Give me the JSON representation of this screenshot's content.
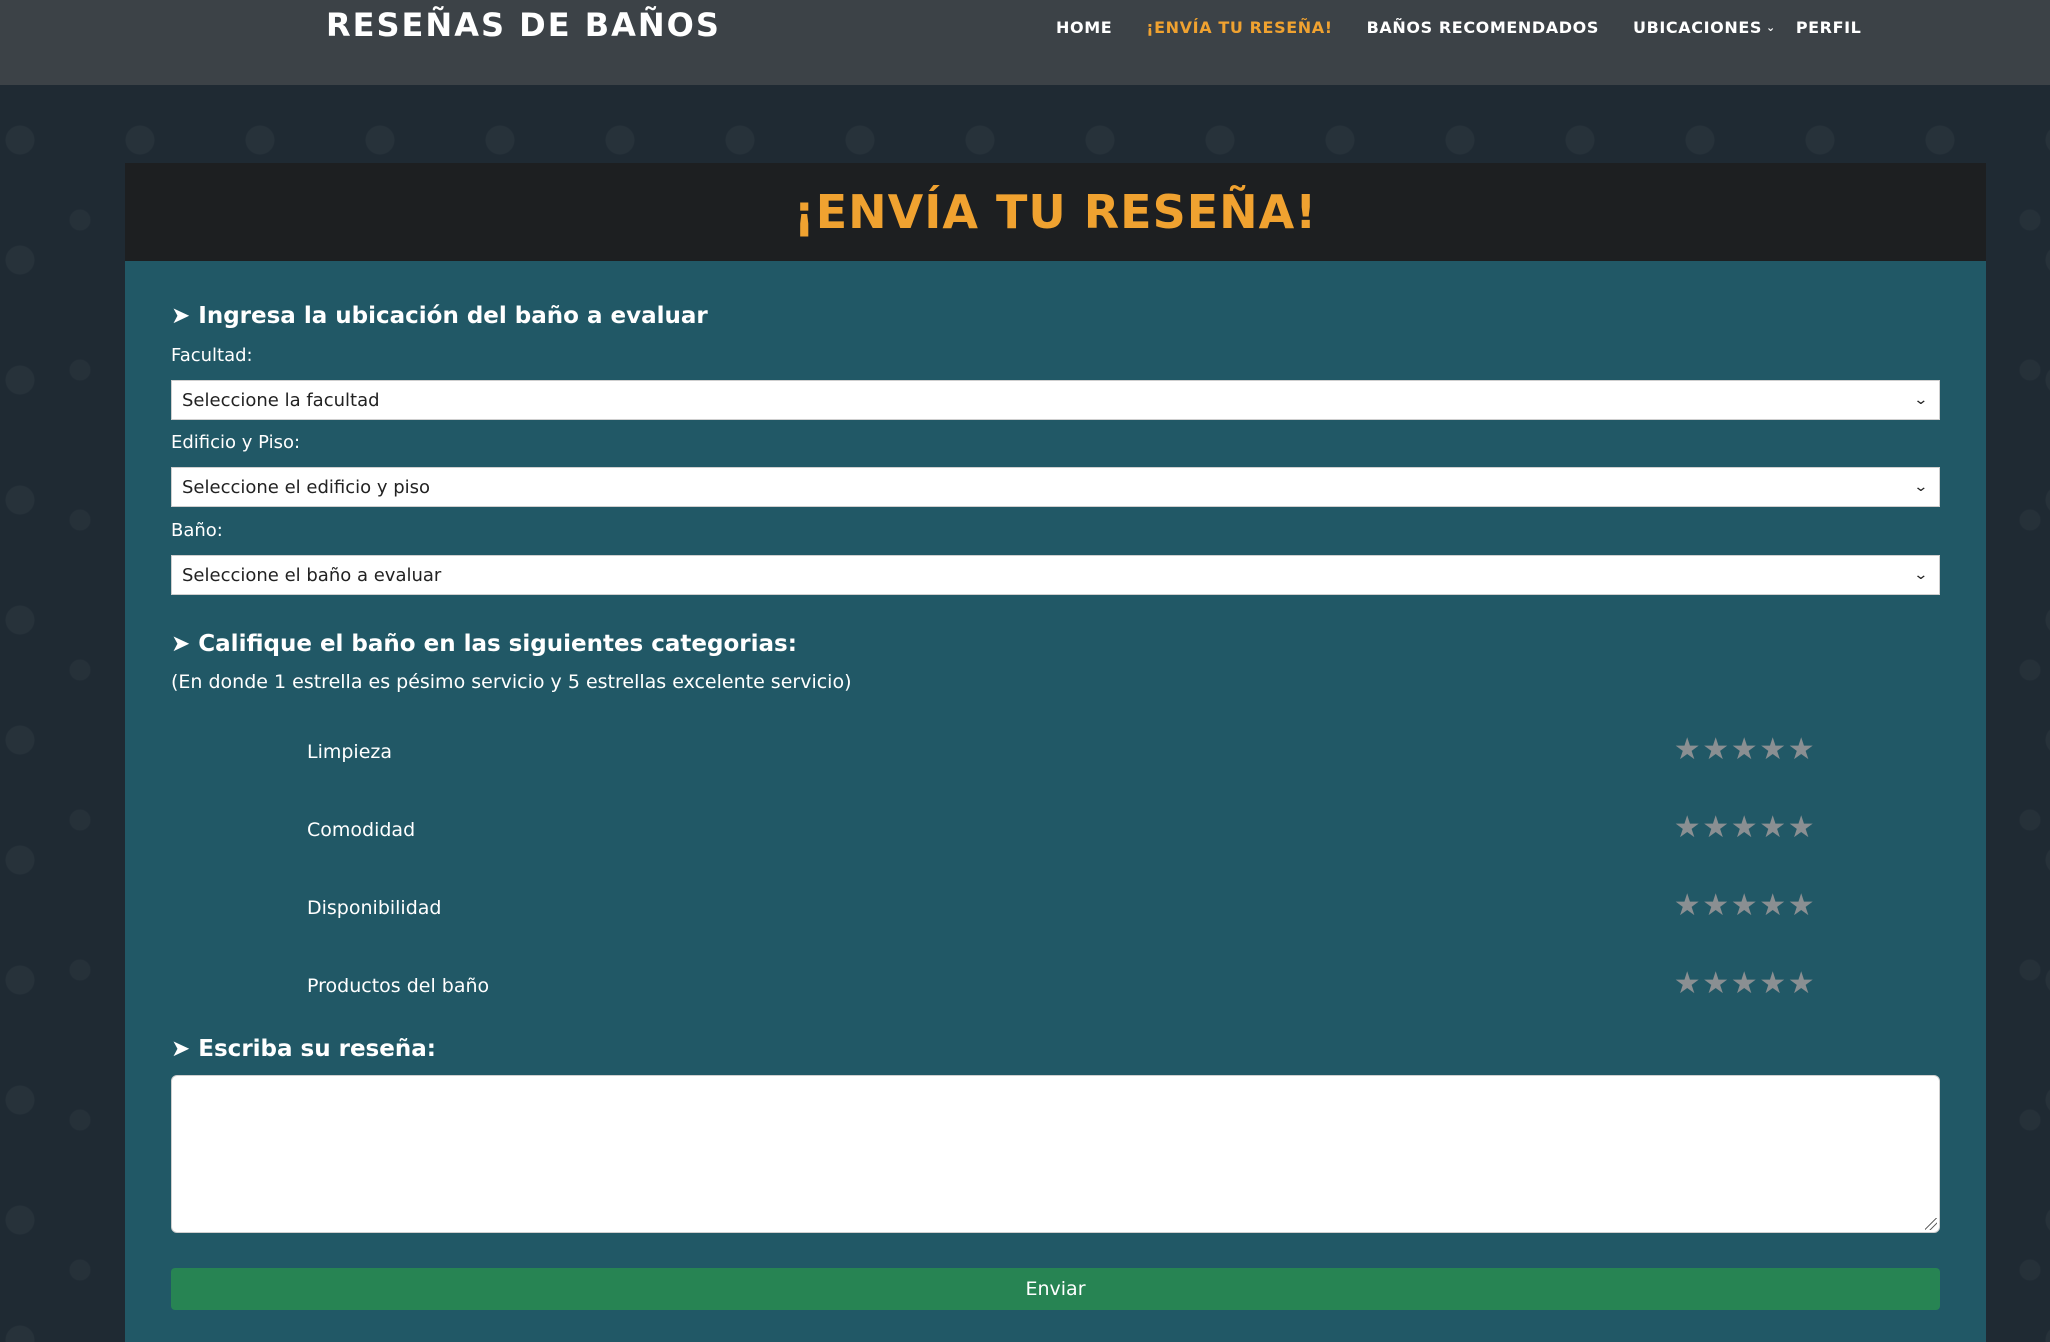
{
  "nav": {
    "brand": "RESEÑAS DE BAÑOS",
    "links": [
      {
        "label": "HOME"
      },
      {
        "label": "¡ENVÍA TU RESEÑA!"
      },
      {
        "label": "BAÑOS RECOMENDADOS"
      },
      {
        "label": "UBICACIONES"
      },
      {
        "label": "PERFIL"
      }
    ],
    "active_color": "#f0a230"
  },
  "card": {
    "title": "¡ENVÍA TU RESEÑA!",
    "location_section": "➤ Ingresa la ubicación del baño a evaluar",
    "fields": [
      {
        "label": "Facultad:",
        "selected": "Seleccione la facultad"
      },
      {
        "label": "Edificio y Piso:",
        "selected": "Seleccione el edificio y piso"
      },
      {
        "label": "Baño:",
        "selected": "Seleccione el baño a evaluar"
      }
    ],
    "rating_section": "➤ Califique el baño en las siguientes categorias:",
    "rating_hint": "(En donde 1 estrella es pésimo servicio y 5 estrellas excelente servicio)",
    "ratings": [
      {
        "label": "Limpieza",
        "stars": 5,
        "value": 0
      },
      {
        "label": "Comodidad",
        "stars": 5,
        "value": 0
      },
      {
        "label": "Disponibilidad",
        "stars": 5,
        "value": 0
      },
      {
        "label": "Productos del baño",
        "stars": 5,
        "value": 0
      }
    ],
    "review_section": "➤ Escriba su reseña:",
    "review_value": "",
    "submit_label": "Enviar"
  },
  "colors": {
    "accent": "#f0a230",
    "panel": "#215866",
    "header": "#1d1f21",
    "submit": "#278453"
  }
}
